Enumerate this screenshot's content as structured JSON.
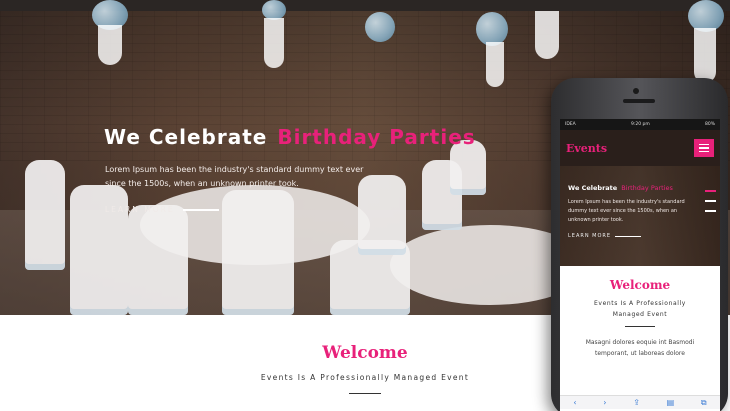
{
  "hero": {
    "title_main": "We Celebrate",
    "title_accent": "Birthday Parties",
    "description": "Lorem Ipsum has been the industry's standard dummy text ever since the 1500s, when an unknown printer took.",
    "link_label": "LEARN MORE"
  },
  "welcome": {
    "title": "Welcome",
    "subtitle": "Events Is A Professionally Managed Event"
  },
  "mobile": {
    "status": {
      "carrier": "IDEA",
      "time": "9:20 pm",
      "battery": "80%"
    },
    "logo": "Events",
    "menu_icon": "hamburger-icon",
    "hero": {
      "title_main": "We Celebrate",
      "title_accent": "Birthday Parties",
      "description": "Lorem Ipsum has been the industry's standard dummy text ever since the 1500s, when an unknown printer took.",
      "link_label": "LEARN MORE"
    },
    "welcome": {
      "title": "Welcome",
      "subtitle": "Events Is A Professionally Managed Event",
      "body": "Masagni dolores eoquie int Basmodi temporant, ut laboreas dolore"
    },
    "toolbar": [
      "‹",
      "›",
      "⇪",
      "▤",
      "⧉"
    ]
  },
  "colors": {
    "accent": "#e8217a",
    "dark": "#2a1f1b"
  }
}
